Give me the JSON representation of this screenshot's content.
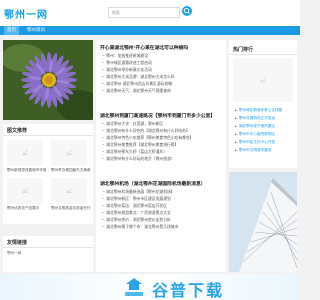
{
  "header": {
    "logo": "鄂州一网",
    "search_placeholder": "搜索",
    "search_icon": "search-icon"
  },
  "nav": {
    "items": [
      {
        "label": "首页"
      },
      {
        "label": "鄂州资讯"
      }
    ]
  },
  "left": {
    "image_text_title": "图文推荐",
    "thumbs": [
      {
        "caption": "鄂州新视觉改善城市环境"
      },
      {
        "caption": "鄂州举办第四届东方美食节"
      },
      {
        "caption": "鄂州优质农产品展示"
      },
      {
        "caption": "鄂州文明旅游志愿者在行动"
      }
    ],
    "friends_title": "友情链接",
    "friends": [
      {
        "label": "鄂州一网"
      }
    ]
  },
  "middle": {
    "articles": [
      {
        "title": "开心果湖北鄂州·开心果在湖北可以种植吗",
        "items": [
          "鄂州：加快推进新城建设",
          "鄂州城区道路改造工程启动",
          "湖北鄂州举办新春文化活动",
          "湖北鄂州大米品牌：湖北鄂州大米怎么样",
          "湖北鄂州·湖北鄂州西山风景区游玩攻略",
          "湖北鄂州天气：湖北鄂州天气预报查询"
        ]
      },
      {
        "title": "湖北鄂州到厦门高速路况【鄂州市到厦门市多少公里】",
        "items": [
          "湖北鄂州大学：红莲湖，鄂州新区",
          "湖北鄂州有什么好吃的【湖北鄂州有什么好吃的】",
          "湖北鄂州特色小吃推荐【鄂州美食特色小吃有哪些】",
          "湖北鄂州美食推荐【湖北鄂州美食排行榜】",
          "湖北鄂州鄂东大桥（葛店大桥通车）",
          "湖北鄂州有什么好玩的地方（鄂州旅游）"
        ]
      },
      {
        "title": "湖北鄂州机场（湖北鄂州花湖国际机场最新消息）",
        "items": [
          "湖北鄂州机场最新进展【鄂州花湖机场】",
          "湖北鄂州新区：鄂州市区建设发展规划",
          "湖北鄂州葛店：湖北鄂州葛店开发区",
          "湖北鄂州旅游景点：广西旅游景点大全",
          "湖北鄂州房价：湖北鄂州房价走势分析",
          "湖北鄂州属于哪个市：湖北鄂州是几线城市"
        ]
      }
    ]
  },
  "right": {
    "hot_title": "热门排行",
    "hot_items": [
      "鄂州城区新增多条公交线路",
      "鄂州花湖机场正式投运",
      "湖北鄂州梁子湖风景区",
      "鄂州市中心医院新院区",
      "鄂州市民文化中心开放",
      "鄂州市文明城市建设"
    ]
  },
  "banner": {
    "text": "谷普下载"
  },
  "colors": {
    "brand": "#1d9ae4",
    "logo": "#1aa3e8"
  }
}
